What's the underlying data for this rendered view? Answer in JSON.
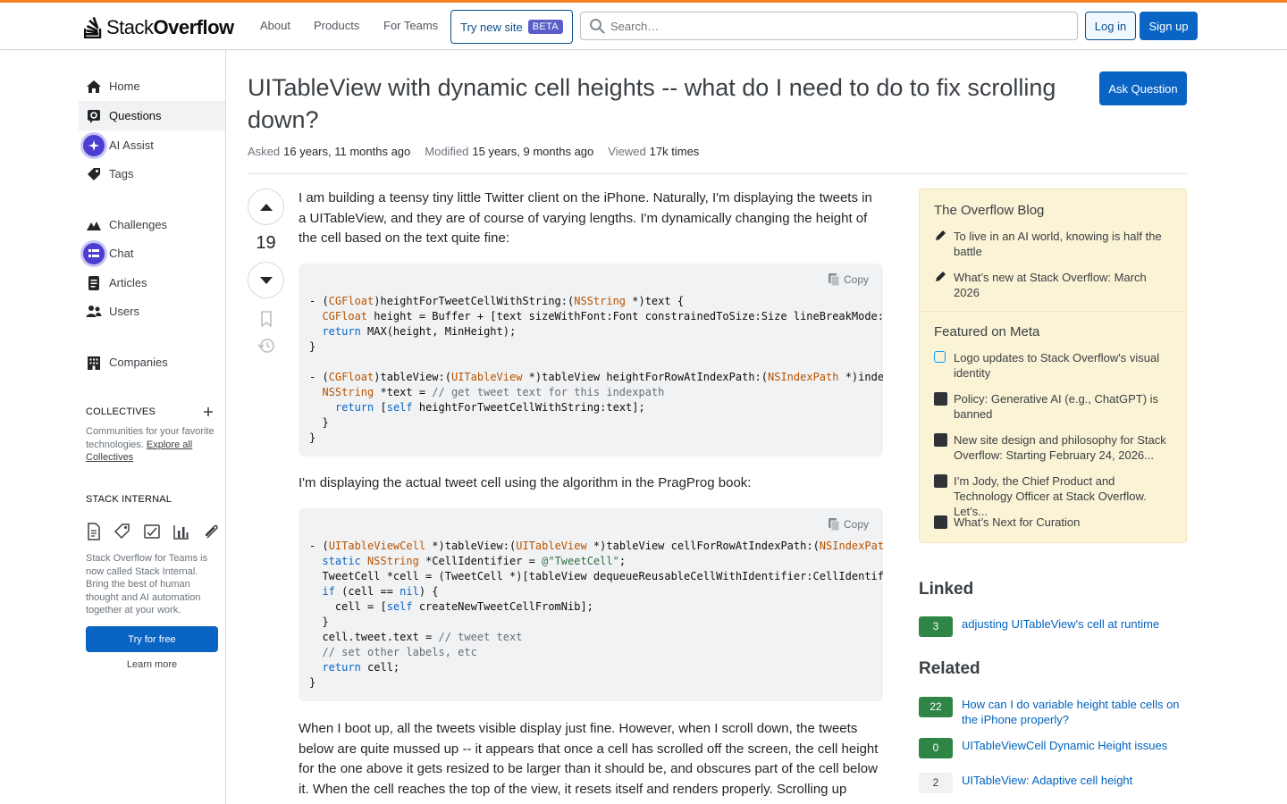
{
  "header": {
    "brand_plain": "Stack",
    "brand_bold": "Overflow",
    "nav": [
      "About",
      "Products",
      "For Teams"
    ],
    "try_new_label": "Try new site",
    "beta_label": "BETA",
    "search_placeholder": "Search…",
    "login_label": "Log in",
    "signup_label": "Sign up",
    "accent_color": "#f48225"
  },
  "sidebar": {
    "items": [
      {
        "label": "Home",
        "icon": "home-icon"
      },
      {
        "label": "Questions",
        "icon": "questions-icon",
        "active": true
      },
      {
        "label": "AI Assist",
        "icon": "ai-assist-icon"
      },
      {
        "label": "Tags",
        "icon": "tag-icon"
      },
      {
        "label": "Challenges",
        "icon": "challenges-icon"
      },
      {
        "label": "Chat",
        "icon": "chat-icon"
      },
      {
        "label": "Articles",
        "icon": "articles-icon"
      },
      {
        "label": "Users",
        "icon": "users-icon"
      },
      {
        "label": "Companies",
        "icon": "companies-icon"
      }
    ],
    "collectives_heading": "COLLECTIVES",
    "collectives_text": "Communities for your favorite technologies.",
    "collectives_link": "Explore all Collectives",
    "stack_internal_heading": "STACK INTERNAL",
    "stack_internal_text": "Stack Overflow for Teams is now called Stack Internal. Bring the best of human thought and AI automation together at your work.",
    "try_free_label": "Try for free",
    "learn_more_label": "Learn more"
  },
  "question": {
    "title": "UITableView with dynamic cell heights -- what do I need to do to fix scrolling down?",
    "ask_label": "Ask Question",
    "asked_label": "Asked",
    "asked_value": "16 years, 11 months ago",
    "modified_label": "Modified",
    "modified_value": "15 years, 9 months ago",
    "viewed_label": "Viewed",
    "viewed_value": "17k times",
    "votes": "19",
    "para1": "I am building a teensy tiny little Twitter client on the iPhone. Naturally, I'm displaying the tweets in a UITableView, and they are of course of varying lengths. I'm dynamically changing the height of the cell based on the text quite fine:",
    "para2": "I'm displaying the actual tweet cell using the algorithm in the PragProg book:",
    "para3": "When I boot up, all the tweets visible display just fine. However, when I scroll down, the tweets below are quite mussed up -- it appears that once a cell has scrolled off the screen, the cell height for the one above it gets resized to be larger than it should be, and obscures part of the cell below it. When the cell reaches the top of the view, it resets itself and renders properly. Scrolling up",
    "copy_label": "Copy"
  },
  "blog": {
    "heading": "The Overflow Blog",
    "items": [
      "To live in an AI world, knowing is half the battle",
      "What’s new at Stack Overflow: March 2026"
    ]
  },
  "meta_featured": {
    "heading": "Featured on Meta",
    "items": [
      "Logo updates to Stack Overflow's visual identity",
      "Policy: Generative AI (e.g., ChatGPT) is banned",
      "New site design and philosophy for Stack Overflow: Starting February 24, 2026...",
      "I’m Jody, the Chief Product and Technology Officer at Stack Overflow. Let’s...",
      "What’s Next for Curation"
    ]
  },
  "linked": {
    "heading": "Linked",
    "items": [
      {
        "count": "3",
        "title": "adjusting UITableView's cell at runtime"
      }
    ]
  },
  "related": {
    "heading": "Related",
    "items": [
      {
        "count": "22",
        "title": "How can I do variable height table cells on the iPhone properly?"
      },
      {
        "count": "0",
        "title": "UITableViewCell Dynamic Height issues"
      },
      {
        "count": "2",
        "title": "UITableView: Adaptive cell height"
      }
    ]
  }
}
